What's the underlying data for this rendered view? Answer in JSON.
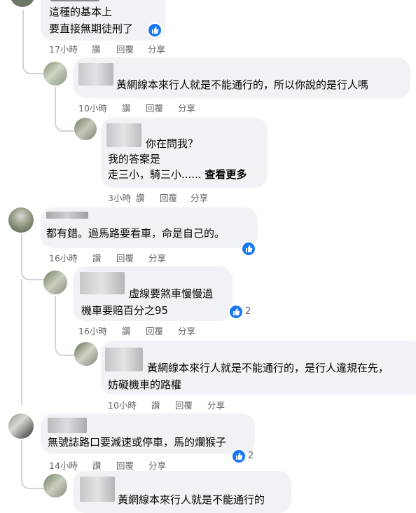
{
  "comments": [
    {
      "id": "c1",
      "lines": [
        "這種的基本上",
        "要直接無期徒刑了"
      ],
      "time": "17小時",
      "like": "讚",
      "reply": "回覆",
      "share": "分享",
      "reaction_count": ""
    },
    {
      "id": "c2",
      "lines": [
        "黃網線本來行人就是不能通行的，所以你說的是行人嗎"
      ],
      "time": "10小時",
      "like": "讚",
      "reply": "回覆",
      "share": "分享"
    },
    {
      "id": "c3",
      "lines": [
        "你在問我？",
        "我的答案是",
        "走三小，騎三小......"
      ],
      "see_more": "查看更多",
      "time": "3小時",
      "like": "讚",
      "reply": "回覆",
      "share": "分享"
    },
    {
      "id": "c4",
      "lines": [
        "都有錯。過馬路要看車，命是自己的。"
      ],
      "time": "16小時",
      "like": "讚",
      "reply": "回覆",
      "share": "分享"
    },
    {
      "id": "c5",
      "lines": [
        "虛線要煞車慢慢過",
        "機車要賠百分之95"
      ],
      "time": "16小時",
      "like": "讚",
      "reply": "回覆",
      "share": "分享",
      "reaction_count": "2"
    },
    {
      "id": "c6",
      "lines": [
        "黃網線本來行人就是不能通行的，是行人違規在先，",
        "妨礙機車的路權"
      ],
      "time": "10小時",
      "like": "讚",
      "reply": "回覆",
      "share": "分享"
    },
    {
      "id": "c7",
      "lines": [
        "無號誌路口要減速或停車，馬的爛猴子"
      ],
      "time": "14小時",
      "like": "讚",
      "reply": "回覆",
      "share": "分享",
      "reaction_count": "2"
    },
    {
      "id": "c8",
      "lines": [
        "黃網線本來行人就是不能通行的"
      ]
    }
  ],
  "colors": {
    "bubble": "#f0f2f5",
    "meta_text": "#65676b",
    "like_blue": "#1877f2",
    "thread_line": "#d0d3d8"
  }
}
